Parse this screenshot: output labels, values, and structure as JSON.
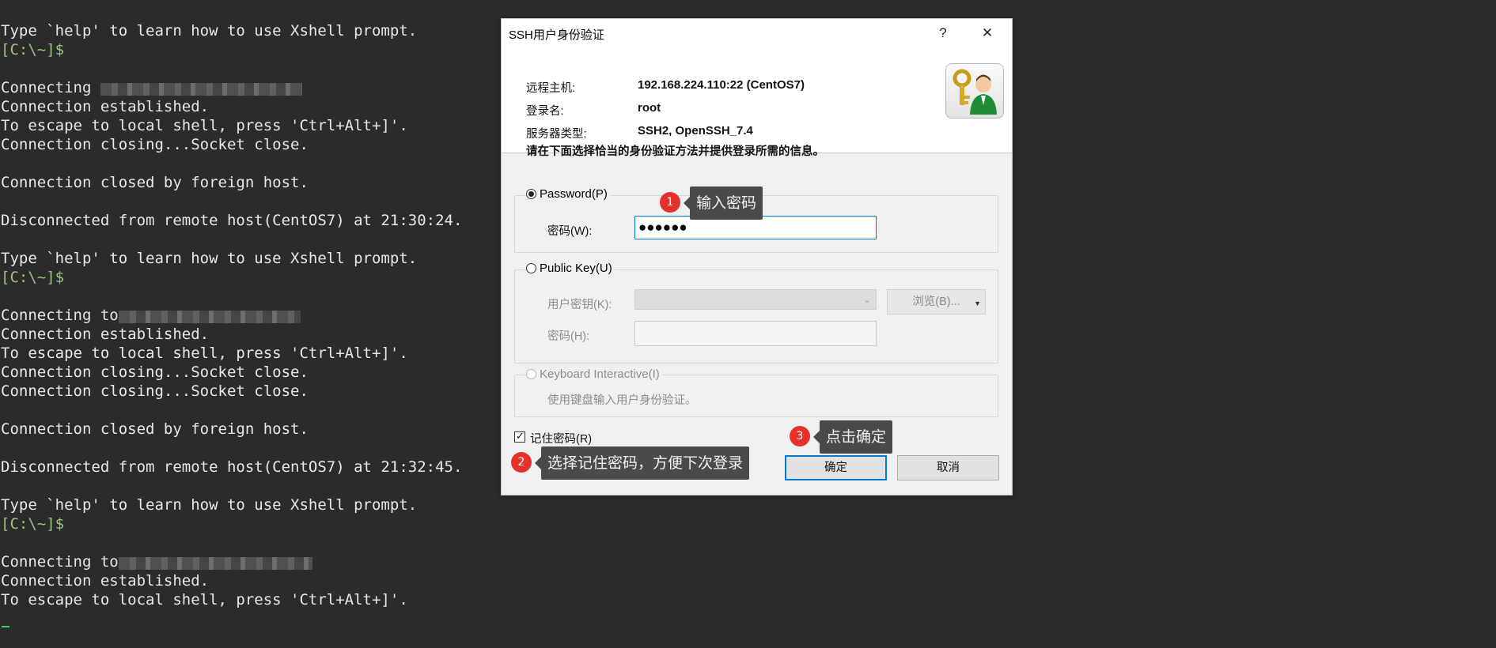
{
  "terminal": {
    "lines": [
      {
        "type": "text",
        "text": "Type `help' to learn how to use Xshell prompt."
      },
      {
        "type": "prompt",
        "text": "[C:\\~]$"
      },
      {
        "type": "blank",
        "text": ""
      },
      {
        "type": "text",
        "text": "Connecting "
      },
      {
        "type": "text",
        "text": "Connection established."
      },
      {
        "type": "text",
        "text": "To escape to local shell, press 'Ctrl+Alt+]'."
      },
      {
        "type": "text",
        "text": "Connection closing...Socket close."
      },
      {
        "type": "blank",
        "text": ""
      },
      {
        "type": "text",
        "text": "Connection closed by foreign host."
      },
      {
        "type": "blank",
        "text": ""
      },
      {
        "type": "text",
        "text": "Disconnected from remote host(CentOS7) at 21:30:24."
      },
      {
        "type": "blank",
        "text": ""
      },
      {
        "type": "text",
        "text": "Type `help' to learn how to use Xshell prompt."
      },
      {
        "type": "prompt",
        "text": "[C:\\~]$"
      },
      {
        "type": "blank",
        "text": ""
      },
      {
        "type": "text",
        "text": "Connecting to"
      },
      {
        "type": "text",
        "text": "Connection established."
      },
      {
        "type": "text",
        "text": "To escape to local shell, press 'Ctrl+Alt+]'."
      },
      {
        "type": "text",
        "text": "Connection closing...Socket close."
      },
      {
        "type": "text",
        "text": "Connection closing...Socket close."
      },
      {
        "type": "blank",
        "text": ""
      },
      {
        "type": "text",
        "text": "Connection closed by foreign host."
      },
      {
        "type": "blank",
        "text": ""
      },
      {
        "type": "text",
        "text": "Disconnected from remote host(CentOS7) at 21:32:45."
      },
      {
        "type": "blank",
        "text": ""
      },
      {
        "type": "text",
        "text": "Type `help' to learn how to use Xshell prompt."
      },
      {
        "type": "prompt",
        "text": "[C:\\~]$"
      },
      {
        "type": "blank",
        "text": ""
      },
      {
        "type": "text",
        "text": "Connecting to"
      },
      {
        "type": "text",
        "text": "Connection established."
      },
      {
        "type": "text",
        "text": "To escape to local shell, press 'Ctrl+Alt+]'."
      }
    ]
  },
  "dialog": {
    "title": "SSH用户身份验证",
    "help_label": "?",
    "close_label": "✕",
    "host_label": "远程主机:",
    "host_value": "192.168.224.110:22 (CentOS7)",
    "login_label": "登录名:",
    "login_value": "root",
    "server_type_label": "服务器类型:",
    "server_type_value": "SSH2, OpenSSH_7.4",
    "instruction": "请在下面选择恰当的身份验证方法并提供登录所需的信息。",
    "password_option": "Password(P)",
    "password_field_label": "密码(W):",
    "password_value": "●●●●●●",
    "publickey_option": "Public Key(U)",
    "user_key_label": "用户密钥(K):",
    "browse_label": "浏览(B)...",
    "passphrase_label": "密码(H):",
    "keyboard_option": "Keyboard Interactive(I)",
    "keyboard_desc": "使用键盘输入用户身份验证。",
    "remember_label": "记住密码(R)",
    "ok_label": "确定",
    "cancel_label": "取消"
  },
  "annotations": [
    {
      "number": "1",
      "text": "输入密码"
    },
    {
      "number": "2",
      "text": "选择记住密码，方便下次登录"
    },
    {
      "number": "3",
      "text": "点击确定"
    }
  ],
  "colors": {
    "terminal_bg": "#2b2b2b",
    "terminal_text": "#e8e8e8",
    "prompt": "#9bc57a",
    "badge_red": "#e4322b",
    "callout_bg": "#4a4a4a",
    "focus_blue": "#0078d7"
  }
}
